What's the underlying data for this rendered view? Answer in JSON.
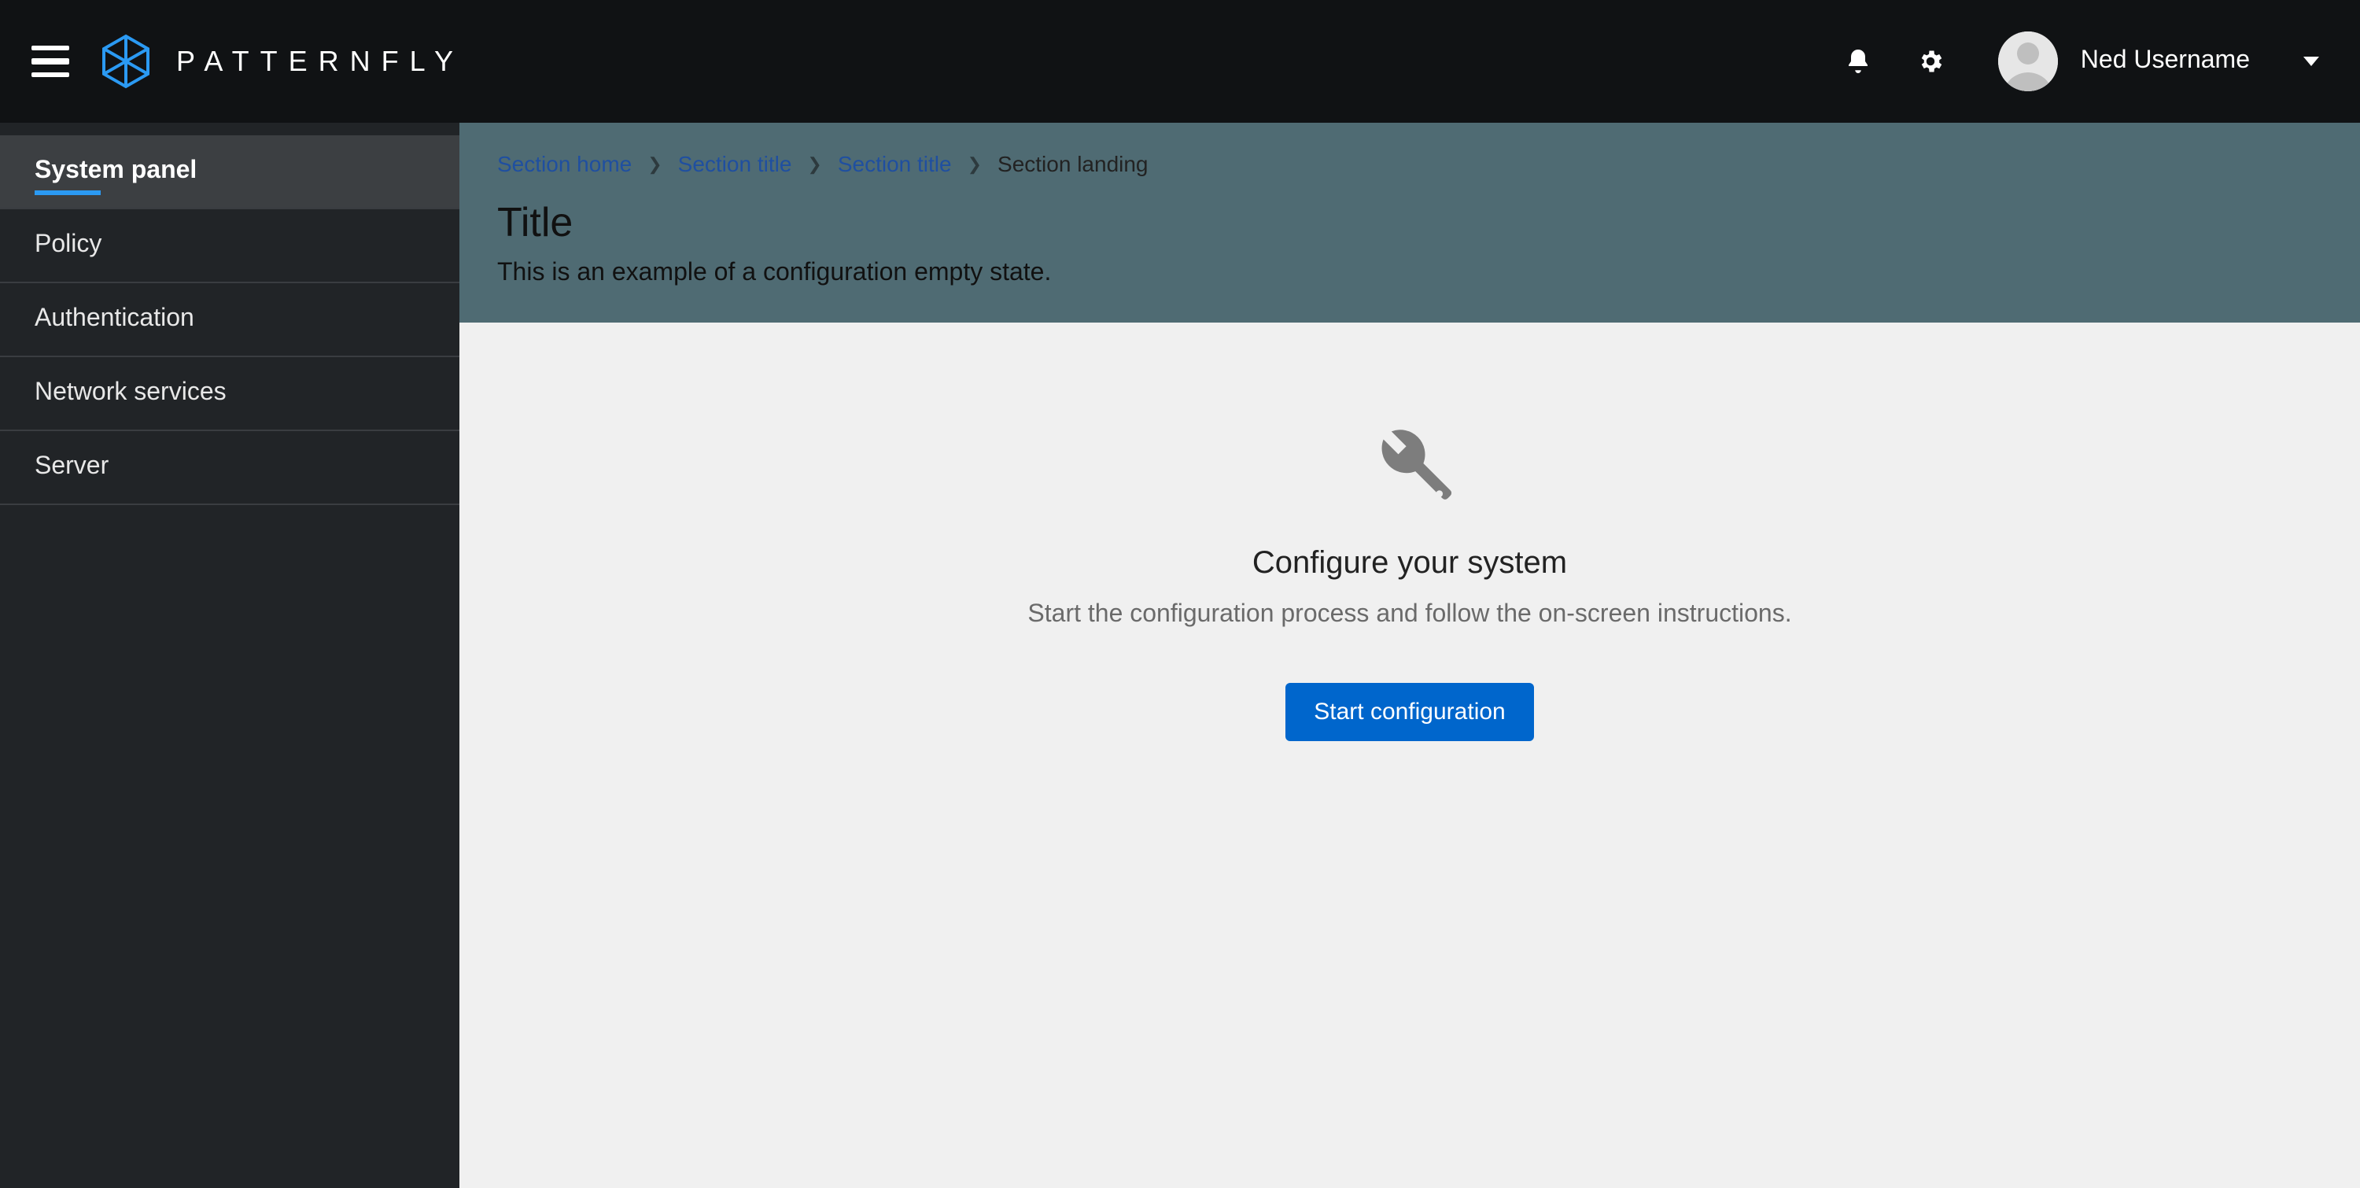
{
  "header": {
    "brand_text": "PATTERNFLY",
    "user_name": "Ned Username"
  },
  "sidebar": {
    "items": [
      {
        "label": "System panel",
        "active": true
      },
      {
        "label": "Policy",
        "active": false
      },
      {
        "label": "Authentication",
        "active": false
      },
      {
        "label": "Network services",
        "active": false
      },
      {
        "label": "Server",
        "active": false
      }
    ]
  },
  "breadcrumb": {
    "items": [
      {
        "label": "Section home",
        "link": true
      },
      {
        "label": "Section title",
        "link": true
      },
      {
        "label": "Section title",
        "link": true
      },
      {
        "label": "Section landing",
        "link": false
      }
    ]
  },
  "page": {
    "title": "Title",
    "description": "This is an example of a configuration empty state."
  },
  "empty_state": {
    "title": "Configure your system",
    "body": "Start the configuration process and follow the on-screen instructions.",
    "button": "Start configuration"
  }
}
